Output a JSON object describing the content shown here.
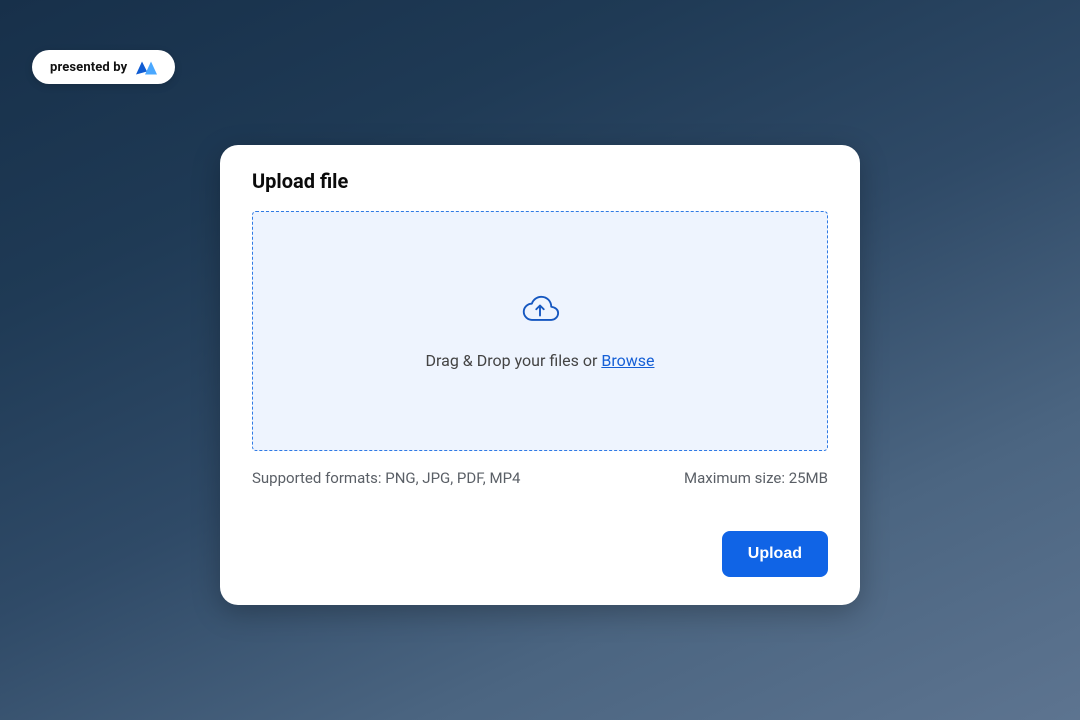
{
  "badge": {
    "text": "presented by"
  },
  "card": {
    "title": "Upload file",
    "dropzone": {
      "text_prefix": "Drag & Drop your files or ",
      "browse_label": "Browse"
    },
    "meta": {
      "supported": "Supported formats: PNG, JPG, PDF, MP4",
      "max_size": "Maximum size: 25MB"
    },
    "actions": {
      "upload_label": "Upload"
    }
  }
}
